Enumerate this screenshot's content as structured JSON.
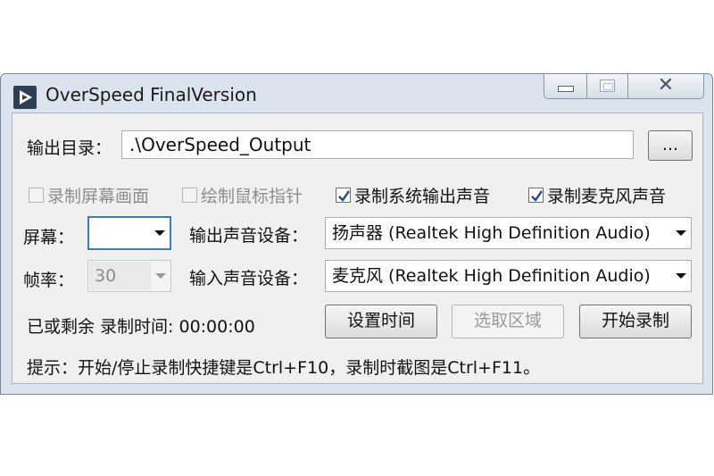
{
  "window": {
    "title": "OverSpeed FinalVersion",
    "caption": {
      "minimize": "",
      "maximize": "",
      "close": "✕"
    }
  },
  "output_dir": {
    "label": "输出目录：",
    "value": ".\\OverSpeed_Output",
    "browse_label": "..."
  },
  "options": {
    "record_screen": {
      "label": "录制屏幕画面",
      "checked": false,
      "enabled": false
    },
    "draw_cursor": {
      "label": "绘制鼠标指针",
      "checked": false,
      "enabled": false
    },
    "record_system_audio": {
      "label": "录制系统输出声音",
      "checked": true,
      "enabled": true
    },
    "record_mic_audio": {
      "label": "录制麦克风声音",
      "checked": true,
      "enabled": true
    }
  },
  "screen": {
    "label": "屏幕：",
    "value": ""
  },
  "output_device": {
    "label": "输出声音设备：",
    "value": "扬声器 (Realtek High Definition Audio)"
  },
  "framerate": {
    "label": "帧率：",
    "value": "30"
  },
  "input_device": {
    "label": "输入声音设备：",
    "value": "麦克风 (Realtek High Definition Audio)"
  },
  "status": {
    "text": "已或剩余 录制时间: 00:00:00"
  },
  "buttons": {
    "set_time": "设置时间",
    "select_region": "选取区域",
    "start_record": "开始录制"
  },
  "hint": {
    "text": "提示：开始/停止录制快捷键是Ctrl+F10，录制时截图是Ctrl+F11。"
  },
  "colors": {
    "title_bar": "#dbe4ee",
    "client_bg": "#f0f0f0",
    "focus_border": "#3c7fb1"
  }
}
